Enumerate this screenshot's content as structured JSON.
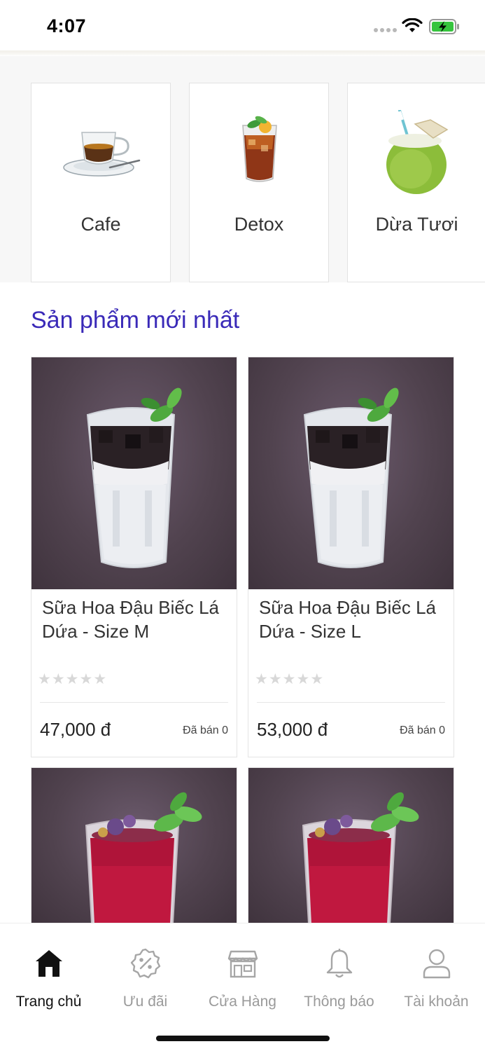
{
  "status_bar": {
    "time": "4:07"
  },
  "categories": [
    {
      "label": "Cafe",
      "icon": "coffee-cup-image"
    },
    {
      "label": "Detox",
      "icon": "iced-tea-image"
    },
    {
      "label": "Dừa Tươi",
      "icon": "coconut-image"
    }
  ],
  "section": {
    "title": "Sản phẩm mới nhất"
  },
  "products": [
    {
      "name": "Sữa Hoa Đậu Biếc Lá Dứa - Size M",
      "price": "47,000 đ",
      "sold": "Đã bán 0",
      "stars": "★★★★★",
      "rating": 0,
      "image": "milk-jelly-drink"
    },
    {
      "name": "Sữa Hoa Đậu Biếc Lá Dứa - Size L",
      "price": "53,000 đ",
      "sold": "Đã bán 0",
      "stars": "★★★★★",
      "rating": 0,
      "image": "milk-jelly-drink"
    },
    {
      "name": "",
      "image": "hibiscus-drink"
    },
    {
      "name": "",
      "image": "hibiscus-drink"
    }
  ],
  "tab_bar": {
    "tabs": [
      {
        "label": "Trang chủ",
        "icon": "home-icon",
        "active": true
      },
      {
        "label": "Ưu đãi",
        "icon": "discount-badge-icon",
        "active": false
      },
      {
        "label": "Cửa Hàng",
        "icon": "store-icon",
        "active": false
      },
      {
        "label": "Thông báo",
        "icon": "bell-icon",
        "active": false
      },
      {
        "label": "Tài khoản",
        "icon": "user-icon",
        "active": false
      }
    ]
  },
  "colors": {
    "accent": "#3a2ab8",
    "active_tab": "#111111",
    "inactive_tab": "#9a9a9a"
  }
}
